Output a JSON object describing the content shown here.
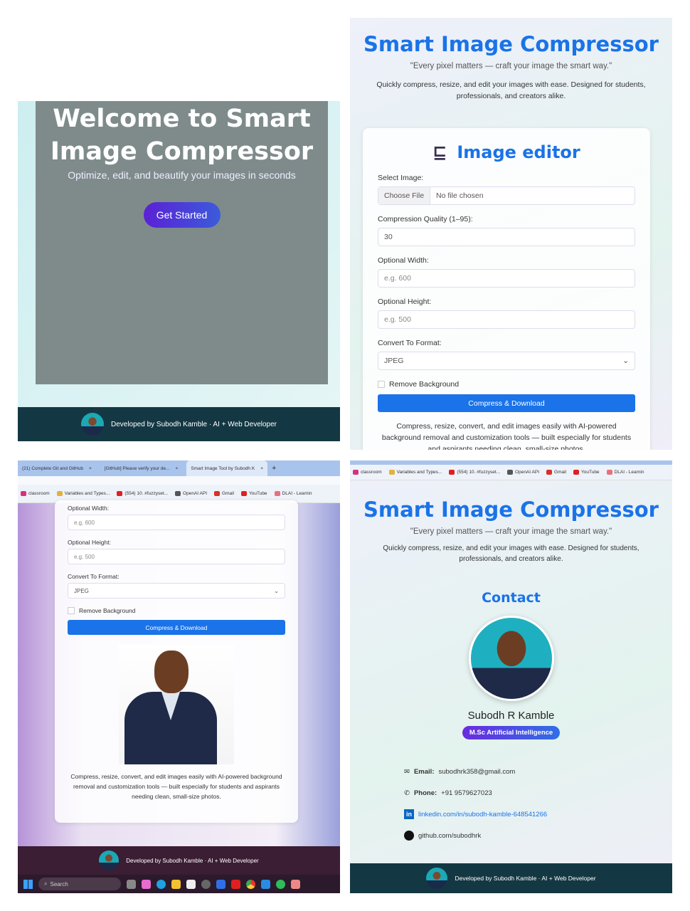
{
  "welcome": {
    "title": "Welcome to Smart Image Compressor",
    "subtitle": "Optimize, edit, and beautify your images in seconds",
    "cta": "Get Started",
    "footer": "Developed by Subodh Kamble · AI + Web Developer"
  },
  "app": {
    "title": "Smart Image Compressor",
    "quote": "\"Every pixel matters — craft your image the smart way.\"",
    "description": "Quickly compress, resize, and edit your images with ease. Designed for students, professionals, and creators alike."
  },
  "editor": {
    "heading": "Image editor",
    "select_label": "Select Image:",
    "choose_file": "Choose File",
    "no_file": "No file chosen",
    "quality_label": "Compression Quality (1–95):",
    "quality_value": "30",
    "width_label": "Optional Width:",
    "width_placeholder": "e.g. 600",
    "height_label": "Optional Height:",
    "height_placeholder": "e.g. 500",
    "format_label": "Convert To Format:",
    "format_value": "JPEG",
    "remove_bg_label": "Remove Background",
    "submit": "Compress & Download",
    "footer_note": "Compress, resize, convert, and edit images easily with AI-powered background removal and customization tools — built especially for students and aspirants needing clean, small-size photos."
  },
  "browser": {
    "tabs": [
      "(21) Complete Git and GitHub",
      "[GitHub] Please verify your de...",
      "Smart Image Tool by Subodh K"
    ],
    "new_tab": "+",
    "bookmarks": [
      "classroom",
      "Variables and Types...",
      "(554) 10. #fuzzyset...",
      "OpenAI API",
      "Gmail",
      "YouTube",
      "DLAI - Learnin"
    ],
    "bookmark_colors": [
      "#d6317f",
      "#e3b23c",
      "#e02020",
      "#555555",
      "#d93025",
      "#e02020",
      "#e8707a"
    ]
  },
  "taskbar": {
    "search": "Search"
  },
  "contact": {
    "heading": "Contact",
    "name": "Subodh R Kamble",
    "badge": "M.Sc Artificial Intelligence",
    "email_label": "Email:",
    "email": "subodhrk358@gmail.com",
    "phone_label": "Phone:",
    "phone": "+91 9579627023",
    "linkedin": "linkedin.com/in/subodh-kamble-648541266",
    "github": "github.com/subodhrk"
  },
  "colors": {
    "accent": "#1a73e8",
    "footer": "#143843"
  }
}
